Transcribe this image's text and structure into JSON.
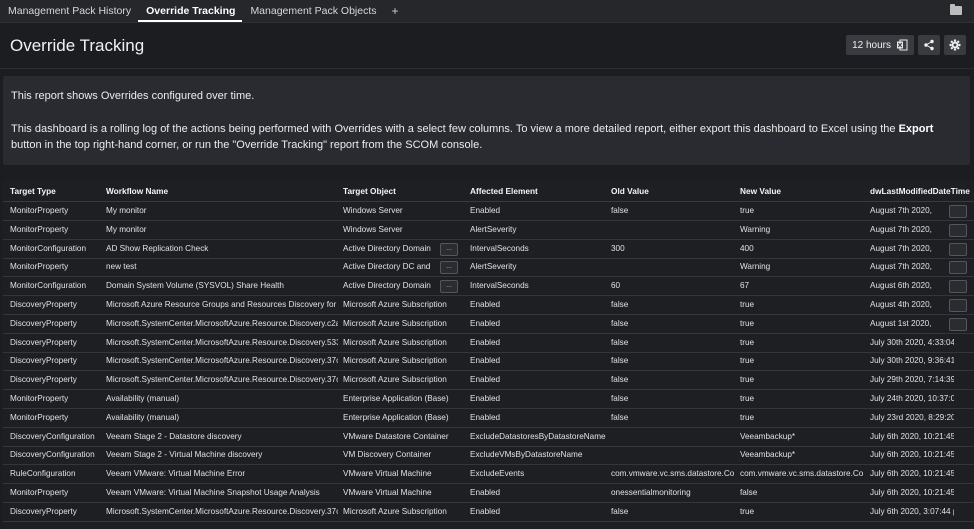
{
  "tabs": [
    {
      "label": "Management Pack History",
      "active": false
    },
    {
      "label": "Override Tracking",
      "active": true
    },
    {
      "label": "Management Pack Objects",
      "active": false
    }
  ],
  "add_tab_label": "+",
  "header": {
    "title": "Override Tracking",
    "time_range": "12 hours"
  },
  "info": {
    "line1": "This report shows Overrides configured over time.",
    "line2_before": "This dashboard is a rolling log of the actions being performed with Overrides with a select few columns. To view a more detailed report, either export this dashboard to Excel using the ",
    "line2_bold": "Export",
    "line2_after": " button in the top right-hand corner, or run the \"Override Tracking\" report from the SCOM console."
  },
  "table": {
    "columns": [
      "Target Type",
      "Workflow Name",
      "Target Object",
      "Affected Element",
      "Old Value",
      "New Value",
      "dwLastModifiedDateTime"
    ],
    "rows": [
      [
        "MonitorProperty",
        "My monitor",
        "Windows Server",
        "Enabled",
        "false",
        "true",
        "August 7th 2020,"
      ],
      [
        "MonitorProperty",
        "My monitor",
        "Windows Server",
        "AlertSeverity",
        "",
        "Warning",
        "August 7th 2020,"
      ],
      [
        "MonitorConfiguration",
        "AD Show Replication Check",
        "Active Directory Domain",
        "IntervalSeconds",
        "300",
        "400",
        "August 7th 2020,"
      ],
      [
        "MonitorProperty",
        "new test",
        "Active Directory DC and",
        "AlertSeverity",
        "",
        "Warning",
        "August 7th 2020,"
      ],
      [
        "MonitorConfiguration",
        "Domain System Volume (SYSVOL) Share Health",
        "Active Directory Domain",
        "IntervalSeconds",
        "60",
        "67",
        "August 6th 2020,"
      ],
      [
        "DiscoveryProperty",
        "Microsoft Azure Resource Groups and Resources Discovery for",
        "Microsoft Azure Subscription",
        "Enabled",
        "false",
        "true",
        "August 4th 2020,"
      ],
      [
        "DiscoveryProperty",
        "Microsoft.SystemCenter.MicrosoftAzure.Resource.Discovery.c2a",
        "Microsoft Azure Subscription",
        "Enabled",
        "false",
        "true",
        "August 1st 2020,"
      ],
      [
        "DiscoveryProperty",
        "Microsoft.SystemCenter.MicrosoftAzure.Resource.Discovery.533",
        "Microsoft Azure Subscription",
        "Enabled",
        "false",
        "true",
        "July 30th 2020, 4:33:04 pm"
      ],
      [
        "DiscoveryProperty",
        "Microsoft.SystemCenter.MicrosoftAzure.Resource.Discovery.37c",
        "Microsoft Azure Subscription",
        "Enabled",
        "false",
        "true",
        "July 30th 2020, 9:36:41 am"
      ],
      [
        "DiscoveryProperty",
        "Microsoft.SystemCenter.MicrosoftAzure.Resource.Discovery.37c",
        "Microsoft Azure Subscription",
        "Enabled",
        "false",
        "true",
        "July 29th 2020, 7:14:39 pm"
      ],
      [
        "MonitorProperty",
        "Availability (manual)",
        "Enterprise Application (Base)",
        "Enabled",
        "false",
        "true",
        "July 24th 2020, 10:37:09 am"
      ],
      [
        "MonitorProperty",
        "Availability (manual)",
        "Enterprise Application (Base)",
        "Enabled",
        "false",
        "true",
        "July 23rd 2020, 8:29:20 pm"
      ],
      [
        "DiscoveryConfiguration",
        "Veeam Stage 2 - Datastore discovery",
        "VMware Datastore Container",
        "ExcludeDatastoresByDatastoreName",
        "",
        "Veeambackup*",
        "July 6th 2020, 10:21:45 pm"
      ],
      [
        "DiscoveryConfiguration",
        "Veeam Stage 2 - Virtual Machine discovery",
        "VM Discovery Container",
        "ExcludeVMsByDatastoreName",
        "",
        "Veeambackup*",
        "July 6th 2020, 10:21:45 pm"
      ],
      [
        "RuleConfiguration",
        "Veeam VMware: Virtual Machine Error",
        "VMware Virtual Machine",
        "ExcludeEvents",
        "com.vmware.vc.sms.datastore.Co",
        "com.vmware.vc.sms.datastore.Co",
        "July 6th 2020, 10:21:45 pm"
      ],
      [
        "MonitorProperty",
        "Veeam VMware: Virtual Machine Snapshot Usage Analysis",
        "VMware Virtual Machine",
        "Enabled",
        "onessentialmonitoring",
        "false",
        "July 6th 2020, 10:21:45 pm"
      ],
      [
        "DiscoveryProperty",
        "Microsoft.SystemCenter.MicrosoftAzure.Resource.Discovery.37c",
        "Microsoft Azure Subscription",
        "Enabled",
        "false",
        "true",
        "July 6th 2020, 3:07:44 pm"
      ]
    ],
    "target_expand_rows": [
      2,
      3,
      4
    ],
    "date_expand_rows": [
      0,
      1,
      2,
      3,
      4,
      5,
      6
    ],
    "expand_glyph": "..."
  },
  "icons": {
    "folder": "folder-icon",
    "excel": "excel-export-icon",
    "share": "share-icon",
    "settings": "gear-icon"
  }
}
